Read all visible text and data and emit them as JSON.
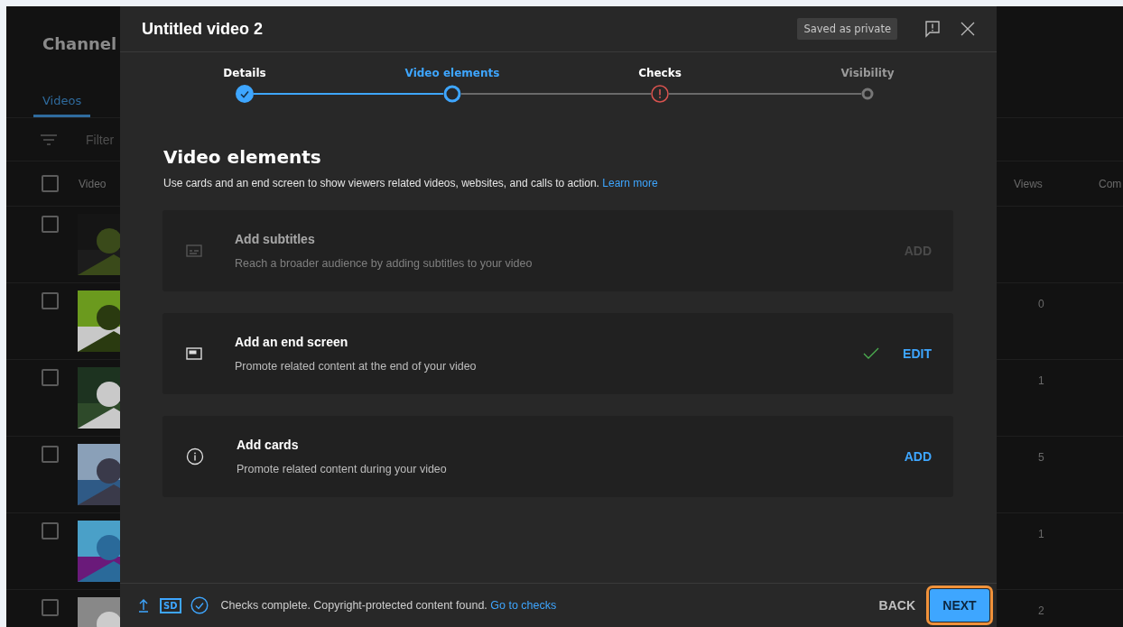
{
  "channel": {
    "title": "Channel",
    "tabs": [
      {
        "label": "Videos",
        "selected": true
      }
    ],
    "filter_placeholder": "Filter",
    "table": {
      "header_checked": false,
      "columns": [
        "Video",
        "Views",
        "Com"
      ],
      "rows": [
        {
          "checked": false
        },
        {
          "checked": false,
          "views": "0"
        },
        {
          "checked": false,
          "views": "1"
        },
        {
          "checked": false,
          "views": "5"
        },
        {
          "checked": false,
          "views": "1"
        },
        {
          "checked": false,
          "views": "2"
        }
      ]
    }
  },
  "dialog": {
    "title": "Untitled video 2",
    "save_status": "Saved as private",
    "steps": [
      {
        "label": "Details",
        "kind": "done",
        "selected": false
      },
      {
        "label": "Video elements",
        "kind": "current",
        "selected": true
      },
      {
        "label": "Checks",
        "kind": "error",
        "selected": false
      },
      {
        "label": "Visibility",
        "kind": "pending",
        "selected": false
      }
    ],
    "heading": "Video elements",
    "description": "Use cards and an end screen to show viewers related videos, websites, and calls to action.",
    "description_link": "Learn more",
    "elements": [
      {
        "kind": "subtitles",
        "title": "Add subtitles",
        "subtitle": "Reach a broader audience by adding subtitles to your video",
        "action": "ADD",
        "disabled": true,
        "done": false
      },
      {
        "kind": "end_screen",
        "title": "Add an end screen",
        "subtitle": "Promote related content at the end of your video",
        "action": "EDIT",
        "disabled": false,
        "done": true
      },
      {
        "kind": "cards",
        "title": "Add cards",
        "subtitle": "Promote related content during your video",
        "action": "ADD",
        "disabled": false,
        "done": false
      }
    ],
    "footer": {
      "quality": "SD",
      "status": "Checks complete. Copyright-protected content found.",
      "link": "Go to checks",
      "back": "BACK",
      "next": "NEXT",
      "next_focused": true
    }
  }
}
